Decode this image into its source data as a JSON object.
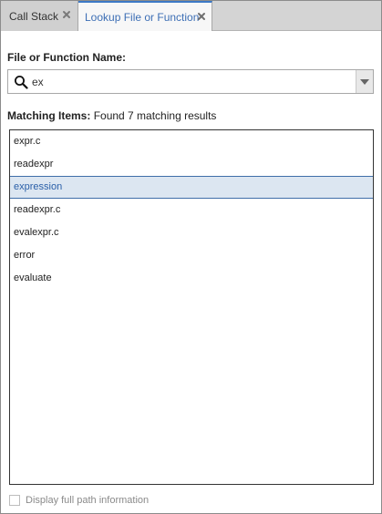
{
  "tabs": [
    {
      "label": "Call Stack",
      "active": false,
      "close_icon": "close-x-icon"
    },
    {
      "label": "Lookup File or Function",
      "active": true,
      "close_icon": "close-x-icon"
    }
  ],
  "lookup": {
    "field_label": "File or Function Name:",
    "search_icon": "search-icon",
    "search_value": "ex",
    "dropdown_icon": "caret-down-icon",
    "matching_label": "Matching Items:",
    "matching_text": "Found 7 matching results",
    "results": [
      {
        "label": "expr.c",
        "selected": false
      },
      {
        "label": "readexpr",
        "selected": false
      },
      {
        "label": "expression",
        "selected": true
      },
      {
        "label": "readexpr.c",
        "selected": false
      },
      {
        "label": "evalexpr.c",
        "selected": false
      },
      {
        "label": "error",
        "selected": false
      },
      {
        "label": "evaluate",
        "selected": false
      }
    ],
    "full_path_label": "Display full path information",
    "full_path_checked": false
  },
  "colors": {
    "accent": "#3d79c6",
    "selection_bg": "#dce6f1",
    "selection_border": "#3f6ea8",
    "tab_strip": "#d4d4d4"
  }
}
